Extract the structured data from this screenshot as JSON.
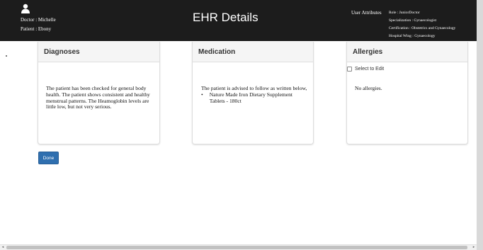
{
  "header": {
    "doctor": "Doctor : Michelle",
    "patient": "Patient : Ebony",
    "title": "EHR Details",
    "user_attributes_label": "User Attributes",
    "attributes": [
      "Role : JuniorDoctor",
      "Specialization : Gynaecologist",
      "Certification : Obstetrics and Gynaecology",
      "Hospital Wing : Gynaecology"
    ]
  },
  "diagnoses": {
    "title": "Diagnoses",
    "text": "The patient has been checked for general body health. The patient shows consistent and healthy menstrual patterns. The Heamoglobin levels are little low, but not very serious."
  },
  "medication": {
    "title": "Medication",
    "intro": "The patient is advised to follow as written below,",
    "items": [
      "Nature Made Iron Dietary Supplement Tablets - 180ct"
    ]
  },
  "allergies": {
    "title": "Allergies",
    "select_label": "Select to Edit",
    "text": "No allergies."
  },
  "done_label": "Done",
  "icons": {
    "user": "user-icon",
    "scroll_left": "chevron-left-icon",
    "scroll_right": "chevron-right-icon"
  }
}
